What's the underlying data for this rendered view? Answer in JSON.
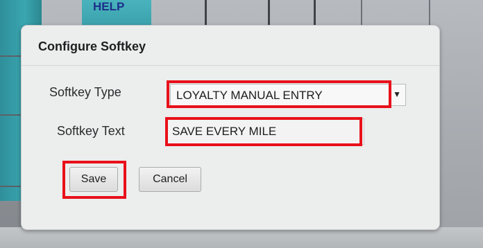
{
  "background": {
    "help_label": "HELP"
  },
  "dialog": {
    "title": "Configure Softkey",
    "softkey_type": {
      "label": "Softkey Type",
      "value": "LOYALTY MANUAL ENTRY"
    },
    "softkey_text": {
      "label": "Softkey Text",
      "value": "SAVE EVERY MILE"
    },
    "buttons": {
      "save": "Save",
      "cancel": "Cancel"
    }
  },
  "colors": {
    "highlight": "#e8101a",
    "dialog_bg": "#eceded",
    "help_text": "#1b2f8a"
  },
  "icons": {
    "dropdown": "chevron-down-icon"
  }
}
